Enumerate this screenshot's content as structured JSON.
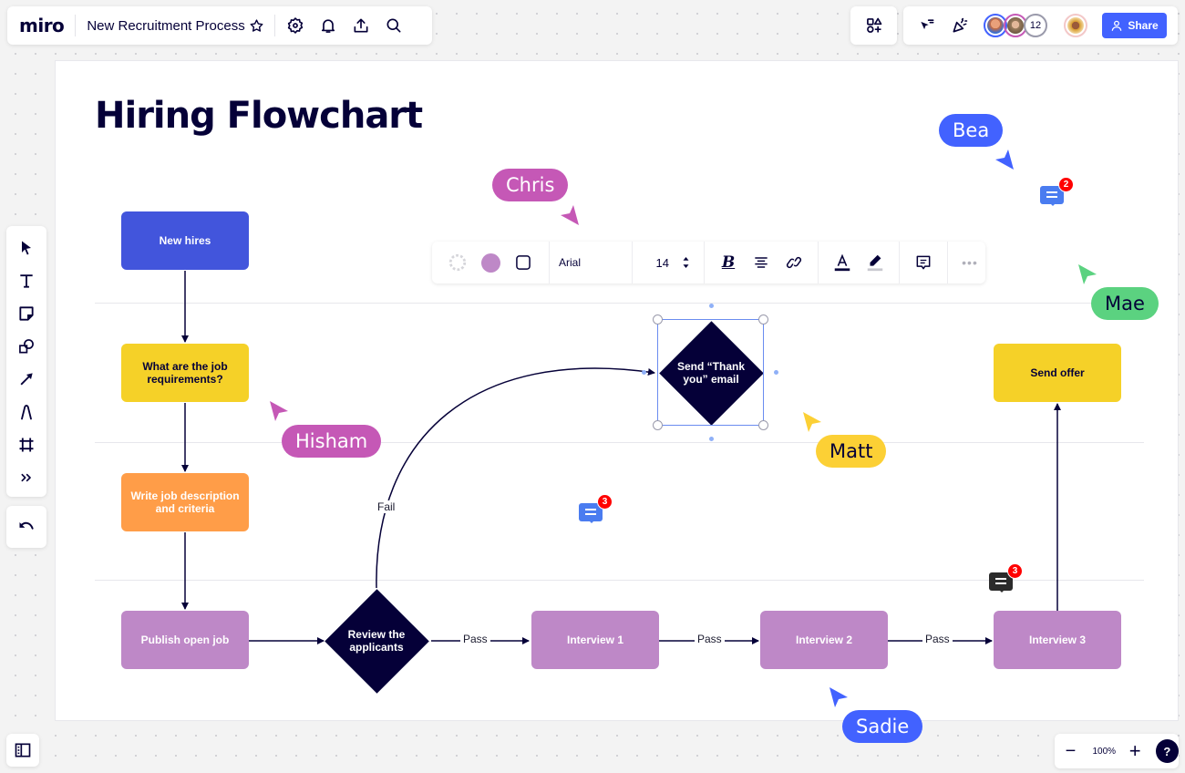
{
  "topbar": {
    "logo": "miro",
    "board_title": "New Recruitment Process",
    "icons": [
      "star-icon",
      "settings-icon",
      "bell-icon",
      "upload-icon",
      "search-icon"
    ]
  },
  "collab": {
    "extra_collaborators": "12",
    "share_label": "Share",
    "avatar_colors": [
      "#4262ff",
      "#c558b6",
      "#9a9aab",
      "#f3b8b8"
    ]
  },
  "left_toolbar": {
    "tools": [
      "select",
      "text",
      "sticky-note",
      "shapes",
      "connection-line",
      "pen",
      "frame",
      "more"
    ]
  },
  "zoom": {
    "level": "100%",
    "minus": "−",
    "plus": "+",
    "help": "?"
  },
  "board": {
    "heading": "Hiring Flowchart",
    "nodes": {
      "new_hires": "New hires",
      "job_requirements": "What are the job requirements?",
      "write_description": "Write job description and criteria",
      "publish": "Publish open job",
      "review": "Review the applicants",
      "thank_you": "Send “Thank you” email",
      "interview1": "Interview 1",
      "interview2": "Interview 2",
      "interview3": "Interview 3",
      "send_offer": "Send offer"
    },
    "edge_labels": {
      "fail": "Fail",
      "pass1": "Pass",
      "pass2": "Pass",
      "pass3": "Pass"
    },
    "colors": {
      "blue": "#4255dc",
      "yellow": "#f5d128",
      "orange": "#ff9d48",
      "purple": "#be88c7",
      "navy": "#050038"
    }
  },
  "context_toolbar": {
    "font": "Arial",
    "font_size": "14",
    "fill_color": "#be88c7"
  },
  "cursors": [
    {
      "name": "Chris",
      "color": "#c558b6",
      "text_color": "#ffffff"
    },
    {
      "name": "Bea",
      "color": "#4262ff",
      "text_color": "#ffffff"
    },
    {
      "name": "Mae",
      "color": "#5bd280",
      "text_color": "#050038"
    },
    {
      "name": "Hisham",
      "color": "#c558b6",
      "text_color": "#ffffff"
    },
    {
      "name": "Matt",
      "color": "#fcd035",
      "text_color": "#050038"
    },
    {
      "name": "Sadie",
      "color": "#4262ff",
      "text_color": "#ffffff"
    }
  ],
  "comments": [
    {
      "count": "2",
      "color": "#4a7cf0"
    },
    {
      "count": "3",
      "color": "#4a7cf0"
    },
    {
      "count": "3",
      "color": "#2b2b2b"
    }
  ]
}
